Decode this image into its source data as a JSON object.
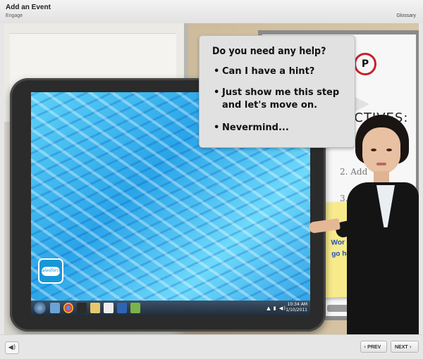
{
  "header": {
    "title": "Add an Event",
    "subtitle": "Engage",
    "glossary_label": "Glossary"
  },
  "help_bubble": {
    "question": "Do you need any help?",
    "options": [
      "Can I have a hint?",
      "Just show me this step and let's move on.",
      "Nevermind..."
    ],
    "bullet": "•"
  },
  "whiteboard": {
    "help_mark": "P",
    "objectives_heading": "ECTIVES:",
    "list_items": [
      "2. Add",
      "3. Ad"
    ],
    "note_lines": [
      "Wor     s wi",
      "go here on this note"
    ]
  },
  "desktop": {
    "logo_text": "salesforce",
    "tray_icons": "▲ ▮ ◀)",
    "clock": [
      "10:34 AM",
      "1/10/2011"
    ]
  },
  "footer": {
    "volume_icon": "◀)",
    "prev_label": "PREV",
    "next_label": "NEXT",
    "prev_chevron": "‹",
    "next_chevron": "›"
  },
  "colors": {
    "note": "#f7ea8b",
    "note_text": "#1d4fb6",
    "help_circle": "#c8202a",
    "screen_blue": "#2aa4e8"
  }
}
